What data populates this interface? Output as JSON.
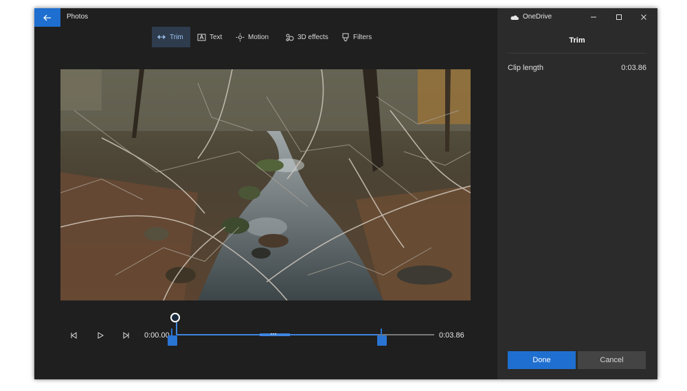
{
  "app": {
    "title": "Photos"
  },
  "toolbar": {
    "items": [
      {
        "label": "Trim",
        "icon": "trim-icon",
        "active": true
      },
      {
        "label": "Text",
        "icon": "text-icon",
        "active": false
      },
      {
        "label": "Motion",
        "icon": "motion-icon",
        "active": false
      },
      {
        "label": "3D effects",
        "icon": "3d-effects-icon",
        "active": false
      },
      {
        "label": "Filters",
        "icon": "filters-icon",
        "active": false
      }
    ]
  },
  "titlebar": {
    "onedrive_label": "OneDrive"
  },
  "panel": {
    "title": "Trim",
    "clip_length_label": "Clip length",
    "clip_length_value": "0:03.86",
    "done_label": "Done",
    "cancel_label": "Cancel"
  },
  "playback": {
    "start_time": "0:00.00",
    "end_time": "0:03.86",
    "playhead_fraction": 0.0,
    "trim_start_fraction": 0.0,
    "trim_end_fraction": 0.78
  },
  "colors": {
    "accent": "#1f6fd0",
    "window_bg": "#1f1f1f",
    "panel_bg": "#2b2b2b"
  }
}
